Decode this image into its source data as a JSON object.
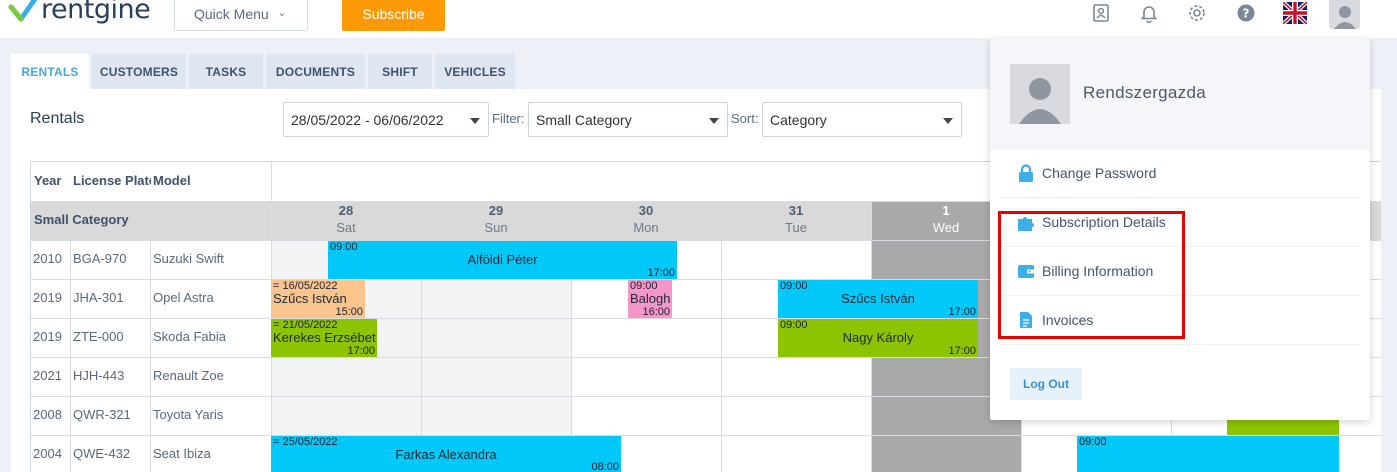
{
  "app": {
    "brand": "rentgine",
    "quick_menu_label": "Quick Menu",
    "subscribe_label": "Subscribe",
    "top_icons": [
      "contacts-icon",
      "bell-icon",
      "gear-icon",
      "help-icon",
      "uk-flag-icon",
      "avatar-icon"
    ],
    "accent_color": "#fe9a05"
  },
  "tabs": [
    {
      "label": "RENTALS",
      "active": true
    },
    {
      "label": "CUSTOMERS",
      "active": false
    },
    {
      "label": "TASKS",
      "active": false
    },
    {
      "label": "DOCUMENTS",
      "active": false
    },
    {
      "label": "SHIFT",
      "active": false
    },
    {
      "label": "VEHICLES",
      "active": false
    }
  ],
  "toolbar": {
    "title": "Rentals",
    "date_range": "28/05/2022 - 06/06/2022",
    "filter_label": "Filter:",
    "filter_value": "Small Category",
    "sort_label": "Sort:",
    "sort_value": "Category"
  },
  "table": {
    "col_year": "Year",
    "col_plate": "License Plate",
    "col_model": "Model",
    "group_label": "Small Category",
    "days": [
      {
        "num": "28",
        "name": "Sat"
      },
      {
        "num": "29",
        "name": "Sun"
      },
      {
        "num": "30",
        "name": "Mon"
      },
      {
        "num": "31",
        "name": "Tue"
      },
      {
        "num": "1",
        "name": "Wed"
      }
    ],
    "rows": [
      {
        "year": "2010",
        "plate": "BGA-970",
        "model": "Suzuki Swift"
      },
      {
        "year": "2019",
        "plate": "JHA-301",
        "model": "Opel Astra"
      },
      {
        "year": "2019",
        "plate": "ZTE-000",
        "model": "Skoda Fabia"
      },
      {
        "year": "2021",
        "plate": "HJH-443",
        "model": "Renault Zoe"
      },
      {
        "year": "2008",
        "plate": "QWR-321",
        "model": "Toyota Yaris"
      },
      {
        "year": "2004",
        "plate": "QWE-432",
        "model": "Seat Ibiza"
      }
    ],
    "bookings": [
      {
        "start": "09:00",
        "end": "17:00",
        "name": "Alföldi Péter",
        "color": "#00c8f8"
      },
      {
        "start": "= 16/05/2022",
        "end": "15:00",
        "name": "Szűcs István",
        "color": "#f9c58d"
      },
      {
        "start": "09:00",
        "end": "16:00",
        "name": "Balogh",
        "color": "#f596c8"
      },
      {
        "start": "09:00",
        "end": "17:00",
        "name": "Szűcs István",
        "color": "#00c8f8"
      },
      {
        "start": "= 21/05/2022",
        "end": "17:00",
        "name": "Kerekes Erzsébet",
        "color": "#8cc400"
      },
      {
        "start": "09:00",
        "end": "17:00",
        "name": "Nagy Károly",
        "color": "#8cc400"
      },
      {
        "start": "= 25/05/2022",
        "end": "08:00",
        "name": "Farkas Alexandra",
        "color": "#00c8f8"
      },
      {
        "start": "09:00",
        "end": "",
        "name": "",
        "color": "#00c8f8"
      },
      {
        "start": "",
        "end": "",
        "name": "",
        "color": "#8cc400"
      }
    ]
  },
  "user_menu": {
    "username": "Rendszergazda",
    "items": [
      {
        "label": "Change Password",
        "icon": "lock-icon"
      },
      {
        "label": "Subscription Details",
        "icon": "puzzle-icon"
      },
      {
        "label": "Billing Information",
        "icon": "wallet-icon"
      },
      {
        "label": "Invoices",
        "icon": "document-icon"
      }
    ],
    "logout_label": "Log Out"
  }
}
